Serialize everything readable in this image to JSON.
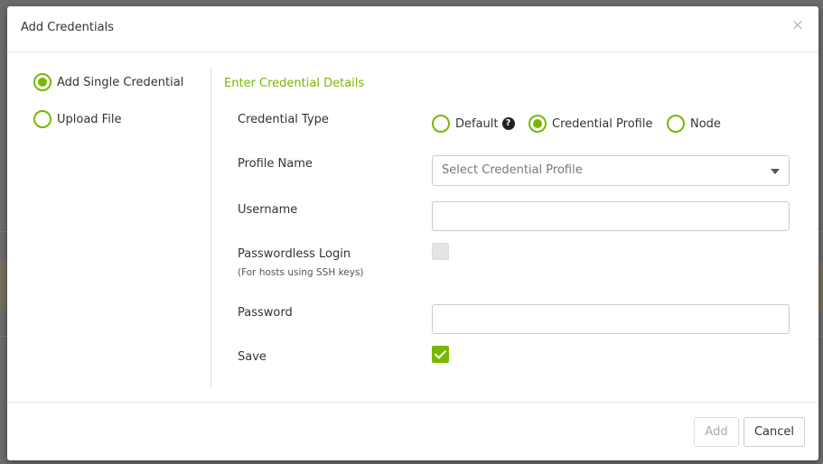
{
  "dialog": {
    "title": "Add Credentials",
    "close_glyph": "×"
  },
  "mode_options": [
    {
      "label": "Add Single Credential",
      "selected": true
    },
    {
      "label": "Upload File",
      "selected": false
    }
  ],
  "details": {
    "section_title": "Enter Credential Details",
    "credential_type": {
      "label": "Credential Type",
      "options": [
        {
          "label": "Default",
          "selected": false,
          "help_glyph": "?"
        },
        {
          "label": "Credential Profile",
          "selected": true
        },
        {
          "label": "Node",
          "selected": false
        }
      ]
    },
    "profile_name": {
      "label": "Profile Name",
      "placeholder": "Select Credential Profile"
    },
    "username": {
      "label": "Username",
      "value": ""
    },
    "passwordless": {
      "label": "Passwordless Login",
      "hint": "(For hosts using SSH keys)",
      "checked": false
    },
    "password": {
      "label": "Password",
      "value": ""
    },
    "save": {
      "label": "Save",
      "checked": true
    }
  },
  "footer": {
    "add_label": "Add",
    "cancel_label": "Cancel"
  },
  "colors": {
    "accent": "#76b900",
    "overlay": "#6b6b6b"
  }
}
